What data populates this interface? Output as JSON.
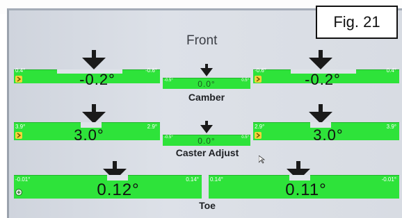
{
  "title": "Front",
  "figure_label": "Fig. 21",
  "rows": [
    {
      "label": "Camber",
      "left": {
        "min": "0.4°",
        "max": "-0.6°",
        "value": "-0.2°"
      },
      "center": {
        "min": "-0.5°",
        "max": "0.5°",
        "value": "0.0°"
      },
      "right": {
        "min": "-0.6°",
        "max": "0.4°",
        "value": "-0.2°"
      }
    },
    {
      "label": "Caster Adjust",
      "left": {
        "min": "3.9°",
        "max": "2.9°",
        "value": "3.0°"
      },
      "center": {
        "min": "-0.5°",
        "max": "0.5°",
        "value": "0.0°"
      },
      "right": {
        "min": "2.9°",
        "max": "3.9°",
        "value": "3.0°"
      }
    },
    {
      "label": "Toe",
      "left": {
        "min": "-0.01°",
        "max": "0.14°",
        "value": "0.12°"
      },
      "right": {
        "min": "0.14°",
        "max": "-0.01°",
        "value": "0.11°"
      }
    }
  ],
  "colors": {
    "gauge_fill": "#2ee33a",
    "panel_bg": "#d8dce3",
    "text": "#111111"
  },
  "icons": {
    "gauge_badge": "chevron-right-icon",
    "toe_badge": "adjust-icon",
    "pointer": "down-arrow-icon"
  }
}
